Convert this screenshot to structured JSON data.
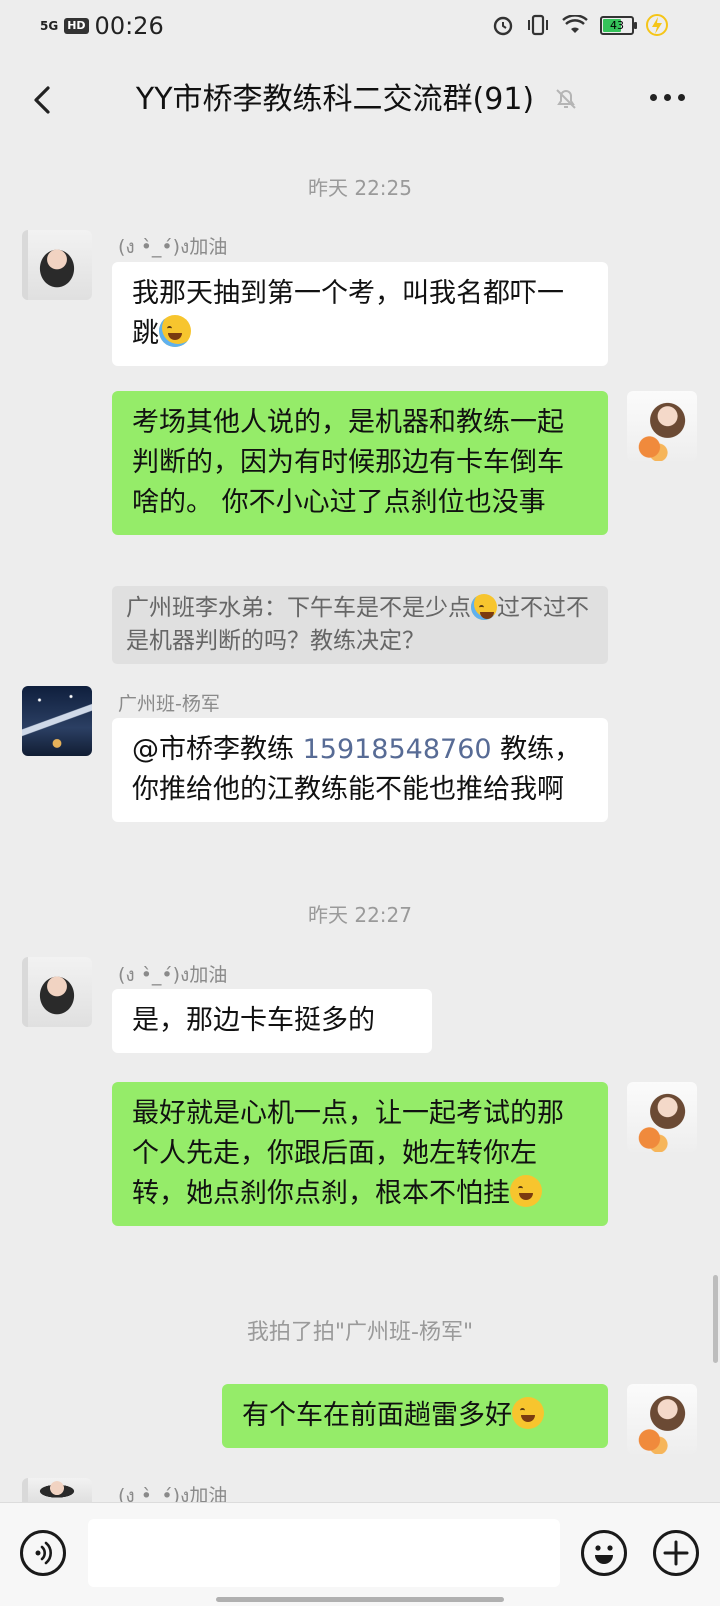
{
  "status_bar": {
    "network": "5G",
    "hd_badge": "HD",
    "time": "00:26",
    "battery": "43"
  },
  "header": {
    "title": "YY市桥李教练科二交流群(91)"
  },
  "messages": {
    "t1": "昨天 22:25",
    "m1": {
      "nick": "(ง •̀_•́)ง加油",
      "text": "我那天抽到第一个考，叫我名都吓一跳"
    },
    "m2": {
      "text": "考场其他人说的，是机器和教练一起判断的，因为有时候那边有卡车倒车啥的。 你不小心过了点刹位也没事"
    },
    "m2_quote": {
      "part1": "广州班李水弟：下午车是不是少点",
      "part2": "过不过不是机器判断的吗？教练决定？"
    },
    "m3": {
      "nick": "广州班-杨军",
      "mention": "@市桥李教练 ",
      "phone": "15918548760",
      "text": " 教练，你推给他的江教练能不能也推给我啊"
    },
    "t2": "昨天 22:27",
    "m4": {
      "nick": "(ง •̀_•́)ง加油",
      "text": "是，那边卡车挺多的"
    },
    "m5": {
      "text": "最好就是心机一点，让一起考试的那个人先走，你跟后面，她左转你左转，她点刹你点刹，根本不怕挂"
    },
    "sys": "我拍了拍\"广州班-杨军\"",
    "m6": {
      "text": "有个车在前面趟雷多好"
    },
    "m7": {
      "nick": "(ง •̀_•́)ง加油"
    }
  },
  "icons": {
    "back": "chevron-left-icon",
    "mute": "bell-off-icon",
    "more": "more-dots-icon",
    "voice": "voice-icon",
    "emoji": "emoji-icon",
    "plus": "plus-icon"
  }
}
